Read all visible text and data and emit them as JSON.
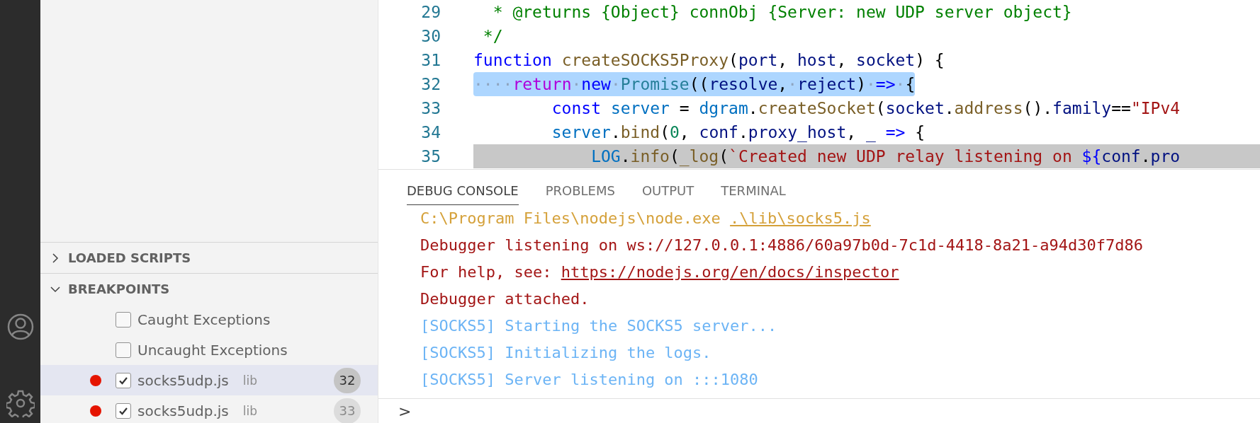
{
  "sidebar": {
    "sections": [
      {
        "title": "LOADED SCRIPTS",
        "expanded": false
      },
      {
        "title": "BREAKPOINTS",
        "expanded": true,
        "items": [
          {
            "kind": "exception",
            "label": "Caught Exceptions",
            "checked": false,
            "selected": false
          },
          {
            "kind": "exception",
            "label": "Uncaught Exceptions",
            "checked": false,
            "selected": false
          },
          {
            "kind": "breakpoint",
            "label": "socks5udp.js",
            "folder": "lib",
            "line": "32",
            "checked": true,
            "selected": true
          },
          {
            "kind": "breakpoint",
            "label": "socks5udp.js",
            "folder": "lib",
            "line": "33",
            "checked": true,
            "selected": false
          }
        ]
      }
    ]
  },
  "editor": {
    "lines": [
      {
        "number": "29",
        "selected": false,
        "current": false,
        "tokens": [
          {
            "kind": "comment",
            "text": "  * @returns {Object} connObj {Server: new UDP server object}"
          }
        ]
      },
      {
        "number": "30",
        "selected": false,
        "current": false,
        "tokens": [
          {
            "kind": "comment",
            "text": " */"
          }
        ]
      },
      {
        "number": "31",
        "selected": false,
        "current": false,
        "tokens": [
          {
            "kind": "keyword",
            "text": "function "
          },
          {
            "kind": "function",
            "text": "createSOCKS5Proxy"
          },
          {
            "kind": "plain",
            "text": "("
          },
          {
            "kind": "variable",
            "text": "port"
          },
          {
            "kind": "plain",
            "text": ", "
          },
          {
            "kind": "variable",
            "text": "host"
          },
          {
            "kind": "plain",
            "text": ", "
          },
          {
            "kind": "variable",
            "text": "socket"
          },
          {
            "kind": "plain",
            "text": ") {"
          }
        ]
      },
      {
        "number": "32",
        "selected": true,
        "current": false,
        "tokens": [
          {
            "kind": "whitespace",
            "text": "····"
          },
          {
            "kind": "control",
            "text": "return"
          },
          {
            "kind": "whitespace",
            "text": "·"
          },
          {
            "kind": "keyword",
            "text": "new"
          },
          {
            "kind": "whitespace",
            "text": "·"
          },
          {
            "kind": "type",
            "text": "Promise"
          },
          {
            "kind": "plain",
            "text": "(("
          },
          {
            "kind": "variable",
            "text": "resolve"
          },
          {
            "kind": "plain",
            "text": ","
          },
          {
            "kind": "whitespace",
            "text": "·"
          },
          {
            "kind": "variable",
            "text": "reject"
          },
          {
            "kind": "plain",
            "text": ")"
          },
          {
            "kind": "whitespace",
            "text": "·"
          },
          {
            "kind": "keyword",
            "text": "=>"
          },
          {
            "kind": "whitespace",
            "text": "·"
          },
          {
            "kind": "plain",
            "text": "{"
          }
        ]
      },
      {
        "number": "33",
        "selected": false,
        "current": false,
        "tokens": [
          {
            "kind": "keyword",
            "text": "        const "
          },
          {
            "kind": "constant",
            "text": "server"
          },
          {
            "kind": "plain",
            "text": " = "
          },
          {
            "kind": "constant",
            "text": "dgram"
          },
          {
            "kind": "plain",
            "text": "."
          },
          {
            "kind": "function",
            "text": "createSocket"
          },
          {
            "kind": "plain",
            "text": "("
          },
          {
            "kind": "variable",
            "text": "socket"
          },
          {
            "kind": "plain",
            "text": "."
          },
          {
            "kind": "function",
            "text": "address"
          },
          {
            "kind": "plain",
            "text": "()."
          },
          {
            "kind": "variable",
            "text": "family"
          },
          {
            "kind": "plain",
            "text": "=="
          },
          {
            "kind": "string",
            "text": "\"IPv4"
          }
        ]
      },
      {
        "number": "34",
        "selected": false,
        "current": false,
        "tokens": [
          {
            "kind": "constant",
            "text": "        server"
          },
          {
            "kind": "plain",
            "text": "."
          },
          {
            "kind": "function",
            "text": "bind"
          },
          {
            "kind": "plain",
            "text": "("
          },
          {
            "kind": "number",
            "text": "0"
          },
          {
            "kind": "plain",
            "text": ", "
          },
          {
            "kind": "variable",
            "text": "conf"
          },
          {
            "kind": "plain",
            "text": "."
          },
          {
            "kind": "variable",
            "text": "proxy_host"
          },
          {
            "kind": "plain",
            "text": ", "
          },
          {
            "kind": "variable",
            "text": "_ "
          },
          {
            "kind": "keyword",
            "text": "=>"
          },
          {
            "kind": "plain",
            "text": " {"
          }
        ]
      },
      {
        "number": "35",
        "selected": false,
        "current": true,
        "tokens": [
          {
            "kind": "constant",
            "text": "            LOG"
          },
          {
            "kind": "plain",
            "text": "."
          },
          {
            "kind": "function",
            "text": "info"
          },
          {
            "kind": "plain",
            "text": "("
          },
          {
            "kind": "function",
            "text": "_log"
          },
          {
            "kind": "plain",
            "text": "("
          },
          {
            "kind": "string",
            "text": "`Created new UDP relay listening on "
          },
          {
            "kind": "keyword",
            "text": "${"
          },
          {
            "kind": "variable",
            "text": "conf"
          },
          {
            "kind": "plain",
            "text": "."
          },
          {
            "kind": "variable",
            "text": "pro"
          }
        ]
      }
    ]
  },
  "panel": {
    "tabs": [
      {
        "label": "DEBUG CONSOLE",
        "selected": true
      },
      {
        "label": "PROBLEMS",
        "selected": false
      },
      {
        "label": "OUTPUT",
        "selected": false
      },
      {
        "label": "TERMINAL",
        "selected": false
      }
    ],
    "console": [
      {
        "kind": "command",
        "parts": [
          {
            "text": "C:\\Program Files\\nodejs\\node.exe "
          },
          {
            "text": ".\\lib\\socks5.js",
            "link": true
          }
        ]
      },
      {
        "kind": "stderr",
        "parts": [
          {
            "text": "Debugger listening on ws://127.0.0.1:4886/60a97b0d-7c1d-4418-8a21-a94d30f7d86"
          }
        ]
      },
      {
        "kind": "stderr",
        "parts": [
          {
            "text": "For help, see: "
          },
          {
            "text": "https://nodejs.org/en/docs/inspector",
            "link": true
          }
        ]
      },
      {
        "kind": "stderr",
        "parts": [
          {
            "text": "Debugger attached."
          }
        ]
      },
      {
        "kind": "stdout",
        "parts": [
          {
            "text": "[SOCKS5] Starting the SOCKS5 server..."
          }
        ]
      },
      {
        "kind": "stdout",
        "parts": [
          {
            "text": "[SOCKS5] Initializing the logs."
          }
        ]
      },
      {
        "kind": "stdout",
        "parts": [
          {
            "text": "[SOCKS5] Server listening on :::1080"
          }
        ]
      }
    ],
    "prompt": ">"
  }
}
